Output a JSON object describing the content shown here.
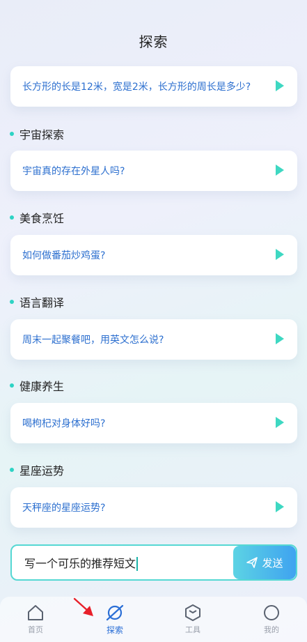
{
  "header": {
    "title": "探索"
  },
  "top_card": {
    "text": "长方形的长是12米，宽是2米，长方形的周长是多少?"
  },
  "sections": [
    {
      "label": "宇宙探索",
      "question": "宇宙真的存在外星人吗?"
    },
    {
      "label": "美食烹饪",
      "question": "如何做番茄炒鸡蛋?"
    },
    {
      "label": "语言翻译",
      "question": "周末一起聚餐吧，用英文怎么说?"
    },
    {
      "label": "健康养生",
      "question": "喝枸杞对身体好吗?"
    },
    {
      "label": "星座运势",
      "question": "天秤座的星座运势?"
    }
  ],
  "input": {
    "value": "写一个可乐的推荐短文",
    "send_label": "发送"
  },
  "tabbar": {
    "items": [
      {
        "label": "首页",
        "icon": "home-icon"
      },
      {
        "label": "探索",
        "icon": "explore-planet-icon",
        "active": true
      },
      {
        "label": "工具",
        "icon": "cube-icon"
      },
      {
        "label": "我的",
        "icon": "profile-circle-icon"
      }
    ]
  },
  "colors": {
    "accent_blue": "#2c6fcf",
    "accent_teal": "#2dd3c4",
    "play_icon": "#3ed8c2",
    "annotation_arrow": "#e8202a"
  }
}
